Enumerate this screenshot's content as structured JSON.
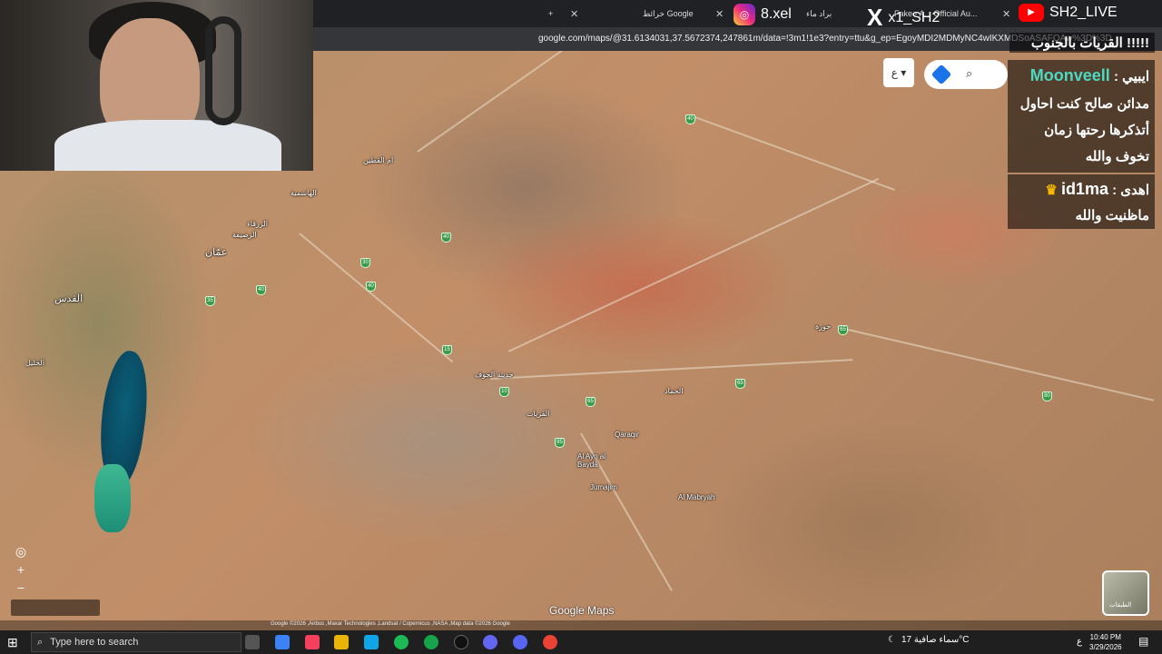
{
  "browser": {
    "tabs": [
      {
        "label": "خرائط Google"
      },
      {
        "label": "براد ماء"
      },
      {
        "label": "Fake - A... Official Au..."
      }
    ],
    "new_tab": "+",
    "url": "google.com/maps/@31.6134031,37.5672374,247861m/data=!3m1!1e3?entry=ttu&g_ep=EgoyMDI2MDMyNC4wIKXMDSoASAFQAw%3D%3D"
  },
  "overlay": {
    "instagram": "8.xel",
    "x_account": "x1_SH2",
    "youtube": "SH2_LIVE",
    "chat": [
      {
        "text": "!!!!! القريات بالجنوب"
      },
      {
        "user": "Moonveell",
        "prefix": "ايبيي :",
        "text": "مدائن صالح كنت احاول أتذكرها رحتها زمان تخوف والله"
      },
      {
        "user": "id1ma",
        "prefix": "اهدى :",
        "text": "ماظنيت والله"
      }
    ]
  },
  "map": {
    "lang_button": "ع",
    "places": [
      {
        "name": "عمّان"
      },
      {
        "name": "القدس"
      },
      {
        "name": "الخليل"
      },
      {
        "name": "Qaraqir"
      },
      {
        "name": "Al Ayn al Baydá"
      },
      {
        "name": "Jumajim"
      },
      {
        "name": "Al Mabryah"
      },
      {
        "name": "الرصيفة"
      },
      {
        "name": "الزرقاء"
      },
      {
        "name": "حوزة"
      },
      {
        "name": "الحماد"
      },
      {
        "name": "القريات"
      },
      {
        "name": "حديثة الجوف"
      },
      {
        "name": "ام القطين"
      },
      {
        "name": "الهاشمية"
      }
    ],
    "highway_numbers": [
      "40",
      "40",
      "40",
      "40",
      "30",
      "35",
      "65",
      "65",
      "80",
      "65",
      "15",
      "10",
      "85"
    ],
    "attribution": "Google ©2026 ,Airbus ,Maxar Technologies ,Landsat / Copernicus ,NASA ,Map data ©2026 Google",
    "logo": "Google Maps",
    "layers_label": "الطبقات"
  },
  "taskbar": {
    "search_placeholder": "Type here to search",
    "weather": "سماء صافية 17°C",
    "time": "10:40 PM",
    "date": "3/29/2026",
    "lang": "ع"
  }
}
